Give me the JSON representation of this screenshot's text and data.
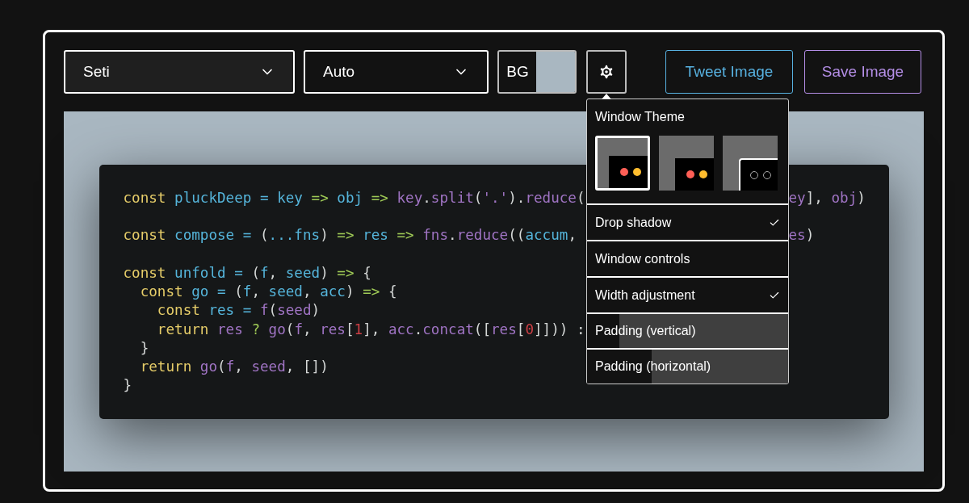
{
  "toolbar": {
    "theme_select": "Seti",
    "language_select": "Auto",
    "background_button": "BG",
    "buttons": [
      {
        "label": "Tweet Image",
        "kind": "tweet"
      },
      {
        "label": "Save Image",
        "kind": "save"
      }
    ]
  },
  "settings_menu": {
    "title": "Window Theme",
    "themes": [
      {
        "kind": "sharp",
        "selected": true
      },
      {
        "kind": "sharp",
        "selected": false
      },
      {
        "kind": "outline",
        "selected": false
      }
    ],
    "options": [
      {
        "kind": "toggle",
        "label": "Drop shadow",
        "checked": true
      },
      {
        "kind": "toggle",
        "label": "Window controls",
        "checked": false
      },
      {
        "kind": "toggle",
        "label": "Width adjustment",
        "checked": true
      },
      {
        "kind": "slider",
        "label": "Padding (vertical)",
        "level": 0.16
      },
      {
        "kind": "slider",
        "label": "Padding (horizontal)",
        "level": 0.32
      }
    ]
  },
  "code_lines": [
    {
      "kind": "code",
      "left": [
        {
          "text": "const ",
          "kind": "kw"
        },
        {
          "text": "pluckDeep = key ",
          "kind": "def"
        },
        {
          "text": "=> ",
          "kind": "op"
        },
        {
          "text": "obj ",
          "kind": "def"
        },
        {
          "text": "=> ",
          "kind": "op"
        },
        {
          "text": "key",
          "kind": "call"
        },
        {
          "text": ".",
          "kind": "plain"
        },
        {
          "text": "split",
          "kind": "call"
        },
        {
          "text": "(",
          "kind": "plain"
        },
        {
          "text": "'.'",
          "kind": "call"
        },
        {
          "text": ").",
          "kind": "plain"
        },
        {
          "text": "reduce",
          "kind": "call"
        },
        {
          "text": "(",
          "kind": "plain"
        }
      ],
      "right": [
        {
          "text": "ey",
          "kind": "call"
        },
        {
          "text": "], ",
          "kind": "plain"
        },
        {
          "text": "obj",
          "kind": "call"
        },
        {
          "text": ")",
          "kind": "plain"
        }
      ]
    },
    {
      "kind": "blank"
    },
    {
      "kind": "code",
      "left": [
        {
          "text": "const ",
          "kind": "kw"
        },
        {
          "text": "compose = ",
          "kind": "def"
        },
        {
          "text": "(",
          "kind": "plain"
        },
        {
          "text": "...fns",
          "kind": "def"
        },
        {
          "text": ") ",
          "kind": "plain"
        },
        {
          "text": "=> ",
          "kind": "op"
        },
        {
          "text": "res ",
          "kind": "def"
        },
        {
          "text": "=> ",
          "kind": "op"
        },
        {
          "text": "fns",
          "kind": "call"
        },
        {
          "text": ".",
          "kind": "plain"
        },
        {
          "text": "reduce",
          "kind": "call"
        },
        {
          "text": "((",
          "kind": "plain"
        },
        {
          "text": "accum",
          "kind": "def"
        },
        {
          "text": ",",
          "kind": "plain"
        }
      ],
      "right": [
        {
          "text": "es",
          "kind": "call"
        },
        {
          "text": ")",
          "kind": "plain"
        }
      ]
    },
    {
      "kind": "blank"
    },
    {
      "kind": "code",
      "left": [
        {
          "text": "const ",
          "kind": "kw"
        },
        {
          "text": "unfold = ",
          "kind": "def"
        },
        {
          "text": "(",
          "kind": "plain"
        },
        {
          "text": "f",
          "kind": "def"
        },
        {
          "text": ", ",
          "kind": "plain"
        },
        {
          "text": "seed",
          "kind": "def"
        },
        {
          "text": ") ",
          "kind": "plain"
        },
        {
          "text": "=> ",
          "kind": "op"
        },
        {
          "text": "{",
          "kind": "plain"
        }
      ]
    },
    {
      "kind": "code",
      "left": [
        {
          "text": "  const ",
          "kind": "kw"
        },
        {
          "text": "go = ",
          "kind": "def"
        },
        {
          "text": "(",
          "kind": "plain"
        },
        {
          "text": "f",
          "kind": "def"
        },
        {
          "text": ", ",
          "kind": "plain"
        },
        {
          "text": "seed",
          "kind": "def"
        },
        {
          "text": ", ",
          "kind": "plain"
        },
        {
          "text": "acc",
          "kind": "def"
        },
        {
          "text": ") ",
          "kind": "plain"
        },
        {
          "text": "=> ",
          "kind": "op"
        },
        {
          "text": "{",
          "kind": "plain"
        }
      ]
    },
    {
      "kind": "code",
      "left": [
        {
          "text": "    const ",
          "kind": "kw"
        },
        {
          "text": "res = ",
          "kind": "def"
        },
        {
          "text": "f",
          "kind": "call"
        },
        {
          "text": "(",
          "kind": "plain"
        },
        {
          "text": "seed",
          "kind": "call"
        },
        {
          "text": ")",
          "kind": "plain"
        }
      ]
    },
    {
      "kind": "code",
      "left": [
        {
          "text": "    return ",
          "kind": "kw"
        },
        {
          "text": "res ",
          "kind": "call"
        },
        {
          "text": "? ",
          "kind": "op"
        },
        {
          "text": "go",
          "kind": "call"
        },
        {
          "text": "(",
          "kind": "plain"
        },
        {
          "text": "f",
          "kind": "call"
        },
        {
          "text": ", ",
          "kind": "plain"
        },
        {
          "text": "res",
          "kind": "call"
        },
        {
          "text": "[",
          "kind": "plain"
        },
        {
          "text": "1",
          "kind": "num"
        },
        {
          "text": "], ",
          "kind": "plain"
        },
        {
          "text": "acc",
          "kind": "call"
        },
        {
          "text": ".",
          "kind": "plain"
        },
        {
          "text": "concat",
          "kind": "call"
        },
        {
          "text": "([",
          "kind": "plain"
        },
        {
          "text": "res",
          "kind": "call"
        },
        {
          "text": "[",
          "kind": "plain"
        },
        {
          "text": "0",
          "kind": "num"
        },
        {
          "text": "]])) :",
          "kind": "plain"
        }
      ]
    },
    {
      "kind": "code",
      "left": [
        {
          "text": "  }",
          "kind": "plain"
        }
      ]
    },
    {
      "kind": "code",
      "left": [
        {
          "text": "  return ",
          "kind": "kw"
        },
        {
          "text": "go",
          "kind": "call"
        },
        {
          "text": "(",
          "kind": "plain"
        },
        {
          "text": "f",
          "kind": "call"
        },
        {
          "text": ", ",
          "kind": "plain"
        },
        {
          "text": "seed",
          "kind": "call"
        },
        {
          "text": ", [])",
          "kind": "plain"
        }
      ]
    },
    {
      "kind": "code",
      "left": [
        {
          "text": "}",
          "kind": "plain"
        }
      ]
    }
  ]
}
